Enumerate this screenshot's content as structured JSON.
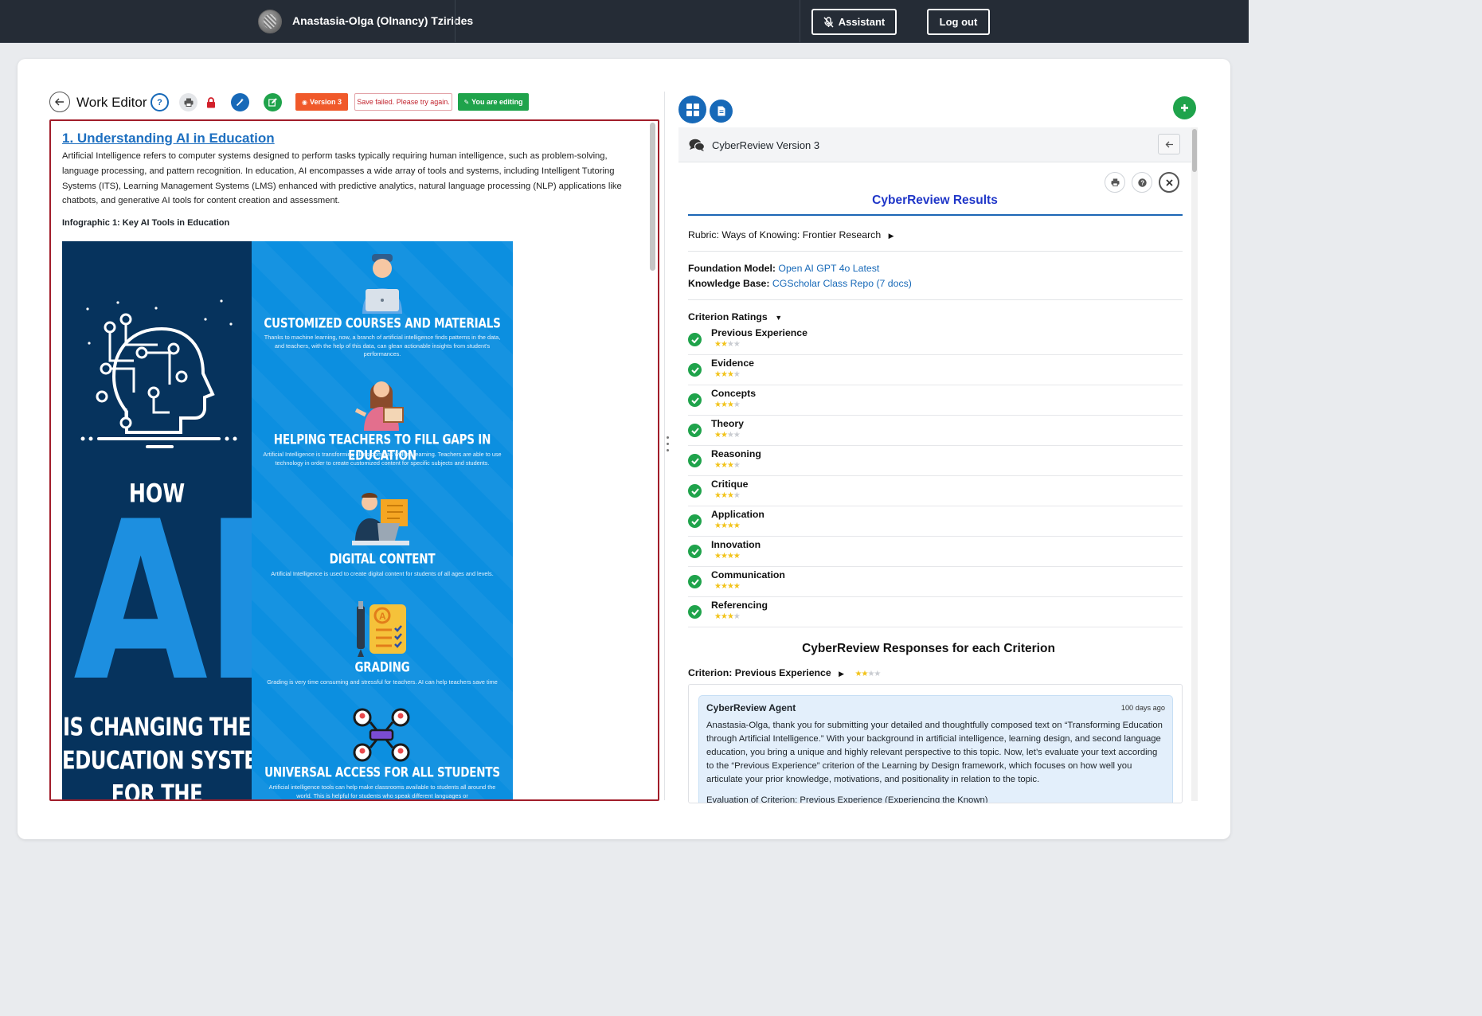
{
  "header": {
    "username": "Anastasia-Olga (Olnancy) Tzirides",
    "assistant_label": "Assistant",
    "logout_label": "Log out"
  },
  "toolbar": {
    "title": "Work Editor",
    "version_tag": "Version 3",
    "save_failed": "Save failed. Please try again.",
    "editing_tag": "You are editing"
  },
  "document": {
    "heading": "1. Understanding AI in Education",
    "paragraph": "Artificial Intelligence refers to computer systems designed to perform tasks typically requiring human intelligence, such as problem-solving, language processing, and pattern recognition. In education, AI encompasses a wide array of tools and systems, including Intelligent Tutoring Systems (ITS), Learning Management Systems (LMS) enhanced with predictive analytics, natural language processing (NLP) applications like chatbots, and generative AI tools for content creation and assessment.",
    "infographic_caption": "Infographic 1: Key AI Tools in Education",
    "infographic": {
      "how": "HOW",
      "ai": "AI",
      "bottom_1": "IS CHANGING THE",
      "bottom_2": "EDUCATION SYSTEM",
      "bottom_3": "FOR THE",
      "sections": [
        {
          "title": "CUSTOMIZED COURSES AND MATERIALS",
          "text": "Thanks to machine learning, now, a branch of artificial intelligence finds patterns in the data, and teachers, with the help of this data, can glean actionable insights from student's performances."
        },
        {
          "title": "HELPING TEACHERS TO FILL GAPS IN EDUCATION",
          "text": "Artificial Intelligence is transforming classrooms as well as learning. Teachers are able to use technology in order to create customized content for specific subjects and students."
        },
        {
          "title": "DIGITAL CONTENT",
          "text": "Artificial Intelligence is used to create digital content for students of all ages and levels."
        },
        {
          "title": "GRADING",
          "text": "Grading is very time consuming and stressful for teachers. AI can help teachers save time"
        },
        {
          "title": "UNIVERSAL ACCESS FOR ALL STUDENTS",
          "text": "Artificial intelligence tools can help make classrooms available to students all around the world. This is helpful for students who speak different languages or"
        }
      ]
    }
  },
  "review": {
    "panel_title": "CyberReview Version 3",
    "results_title": "CyberReview Results",
    "rubric_label": "Rubric: Ways of Knowing: Frontier Research",
    "foundation_label": "Foundation Model:",
    "foundation_value": "Open AI GPT 4o Latest",
    "kb_label": "Knowledge Base:",
    "kb_value": "CGScholar Class Repo (7 docs)",
    "ratings_label": "Criterion Ratings",
    "criteria": [
      {
        "name": "Previous Experience",
        "rating": 2,
        "max": 4
      },
      {
        "name": "Evidence",
        "rating": 3,
        "max": 4
      },
      {
        "name": "Concepts",
        "rating": 3,
        "max": 4
      },
      {
        "name": "Theory",
        "rating": 2,
        "max": 4
      },
      {
        "name": "Reasoning",
        "rating": 3,
        "max": 4
      },
      {
        "name": "Critique",
        "rating": 3,
        "max": 4
      },
      {
        "name": "Application",
        "rating": 4,
        "max": 4
      },
      {
        "name": "Innovation",
        "rating": 4,
        "max": 4
      },
      {
        "name": "Communication",
        "rating": 4,
        "max": 4
      },
      {
        "name": "Referencing",
        "rating": 3,
        "max": 4
      }
    ],
    "responses_title": "CyberReview Responses for each Criterion",
    "criterion_label": "Criterion: Previous Experience",
    "criterion_rating": 2,
    "message": {
      "agent": "CyberReview Agent",
      "time": "100 days ago",
      "body": "Anastasia-Olga, thank you for submitting your detailed and thoughtfully composed text on “Transforming Education through Artificial Intelligence.” With your background in artificial intelligence, learning design, and second language education, you bring a unique and highly relevant perspective to this topic. Now, let’s evaluate your text according to the “Previous Experience” criterion of the Learning by Design framework, which focuses on how well you articulate your prior knowledge, motivations, and positionality in relation to the topic.",
      "more": "Evaluation of Criterion: Previous Experience (Experiencing the Known)"
    }
  },
  "colors": {
    "topbar": "#252c36",
    "accent_blue": "#1769b8",
    "editor_border": "#a11d2a",
    "version_tag": "#f0592a",
    "editing_tag": "#1fa34b",
    "star_on": "#f2c31a"
  }
}
